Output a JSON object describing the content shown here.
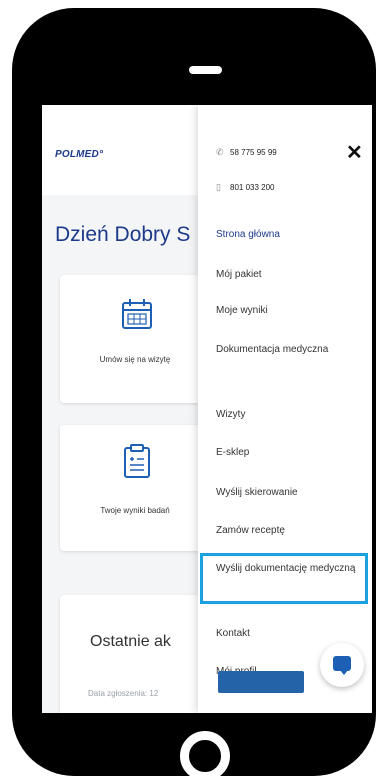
{
  "app": {
    "logo": "POLMED°",
    "greeting": "Dzień Dobry S"
  },
  "cards": [
    {
      "label": "Umów się na wizytę",
      "icon": "calendar-icon"
    },
    {
      "label": "Twoje wyniki badań",
      "icon": "clipboard-icon"
    }
  ],
  "recent": {
    "title": "Ostatnie ak",
    "date_label": "Data zgłoszenia: 12"
  },
  "drawer": {
    "phone": "58 775 95 99",
    "mobile": "801 033 200",
    "close_label": "✕",
    "menu": [
      "Strona główna",
      "Mój pakiet",
      "Moje wyniki",
      "Dokumentacja medyczna",
      "Wizyty",
      "E-sklep",
      "Wyślij skierowanie",
      "Zamów receptę",
      "Wyślij dokumentację medyczną",
      "Kontakt",
      "Mój profil"
    ]
  },
  "colors": {
    "brand": "#1d3a8a",
    "highlight": "#1aa1e0",
    "chat": "#1d5fb4"
  }
}
